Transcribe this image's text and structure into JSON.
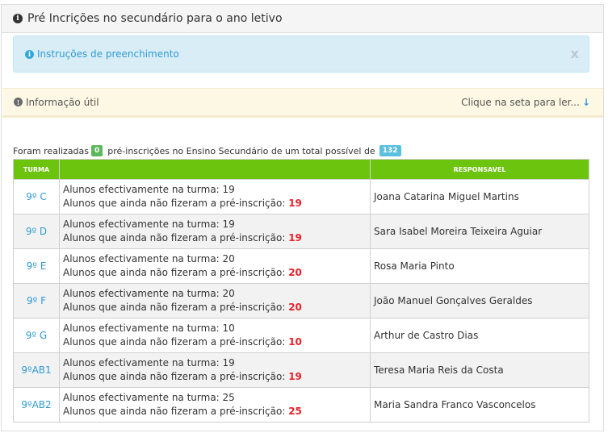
{
  "header": {
    "icon": "info-circle-icon",
    "title": "Pré Incrições no secundário para o ano letivo"
  },
  "instructions": {
    "icon": "info-circle-icon",
    "label": "Instruções de preenchimento",
    "close": "x"
  },
  "info_util": {
    "icon": "exclamation-circle-icon",
    "label": "Informação útil",
    "right_label": "Clique na seta para ler...",
    "arrow_icon": "arrow-down-icon"
  },
  "summary": {
    "prefix": "Foram realizadas",
    "count": "0",
    "middle": "pré-inscrições no Ensino Secundário de um total possível de",
    "total": "132"
  },
  "table": {
    "headers": {
      "turma": "TURMA",
      "info": "",
      "responsavel": "RESPONSAVEL"
    },
    "line1_label": "Alunos efectivamente na turma:",
    "line2_label": "Alunos que ainda não fizeram a pré-inscrição:",
    "rows": [
      {
        "turma": "9º C",
        "alunos": "19",
        "pendentes": "19",
        "responsavel": "Joana Catarina Miguel Martins"
      },
      {
        "turma": "9º D",
        "alunos": "19",
        "pendentes": "19",
        "responsavel": "Sara Isabel Moreira Teixeira Aguiar"
      },
      {
        "turma": "9º E",
        "alunos": "20",
        "pendentes": "20",
        "responsavel": "Rosa Maria Pinto"
      },
      {
        "turma": "9º F",
        "alunos": "20",
        "pendentes": "20",
        "responsavel": "João Manuel Gonçalves Geraldes"
      },
      {
        "turma": "9º G",
        "alunos": "10",
        "pendentes": "10",
        "responsavel": "Arthur de Castro Dias"
      },
      {
        "turma": "9ºAB1",
        "alunos": "19",
        "pendentes": "19",
        "responsavel": "Teresa Maria Reis da Costa"
      },
      {
        "turma": "9ºAB2",
        "alunos": "25",
        "pendentes": "25",
        "responsavel": "Maria Sandra Franco Vasconcelos"
      }
    ]
  },
  "colors": {
    "header_green": "#6cc40e",
    "link_blue": "#2f9bd3",
    "count_red": "#e8212a",
    "badge_green": "#5cb85c",
    "badge_blue": "#5bc0de"
  }
}
